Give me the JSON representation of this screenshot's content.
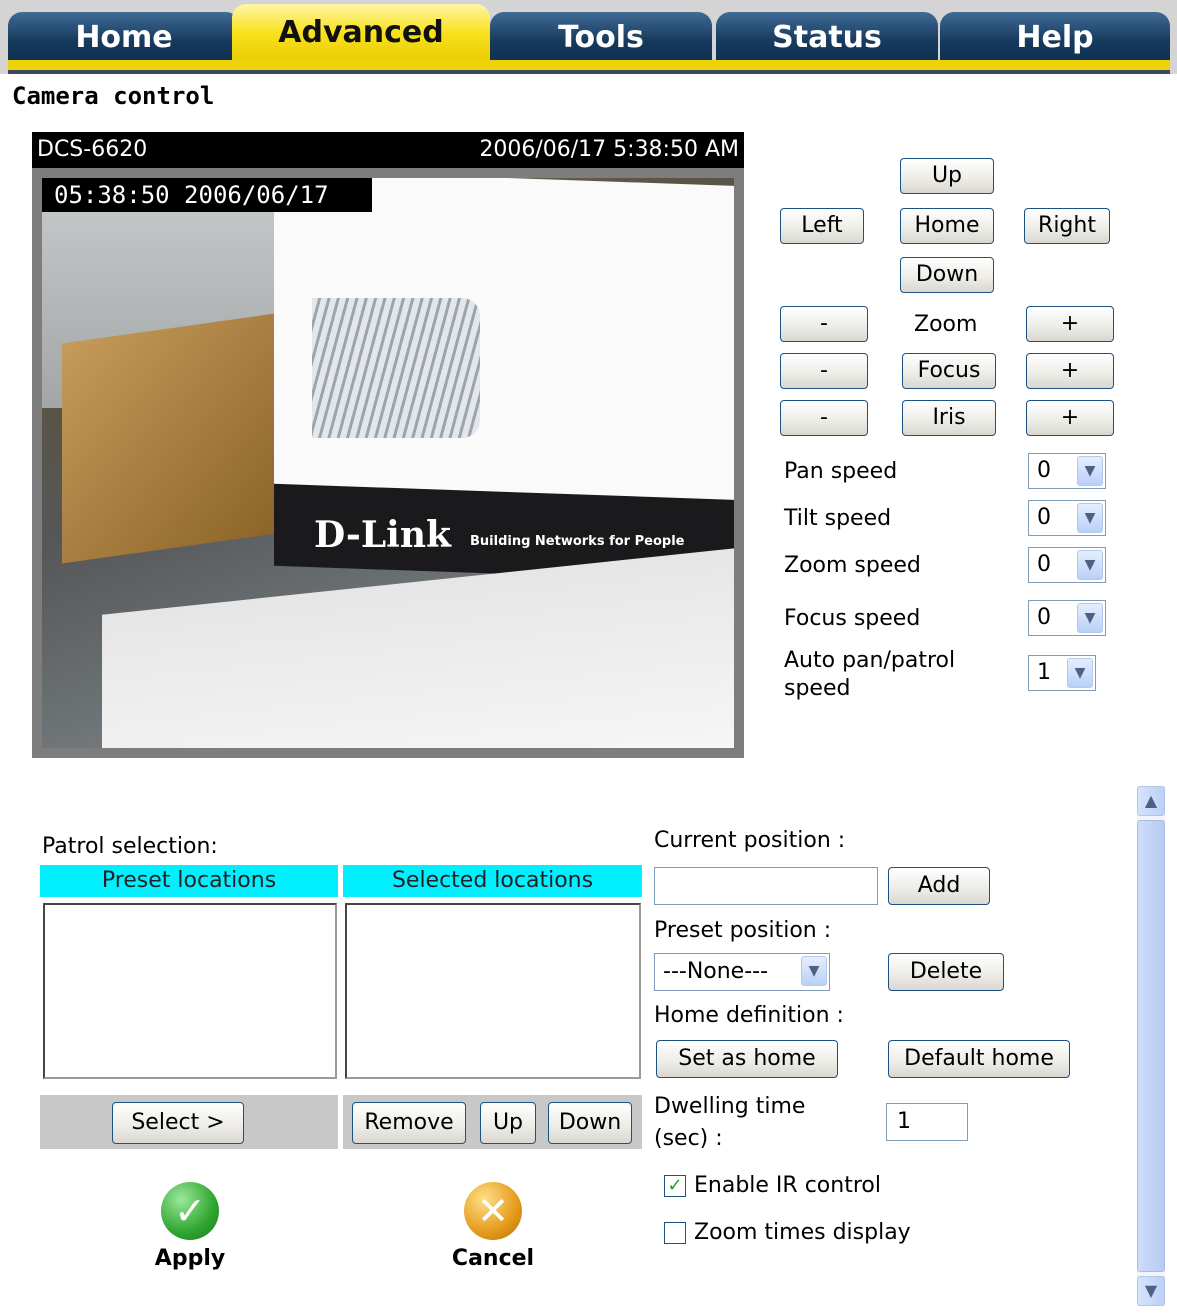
{
  "tabs": [
    {
      "label": "Home",
      "active": false
    },
    {
      "label": "Advanced",
      "active": true
    },
    {
      "label": "Tools",
      "active": false
    },
    {
      "label": "Status",
      "active": false
    },
    {
      "label": "Help",
      "active": false
    }
  ],
  "page_title": "Camera control",
  "camera": {
    "name": "DCS-6620",
    "timestamp": "2006/06/17 5:38:50 AM",
    "osd": "05:38:50  2006/06/17",
    "logo_text": "D-Link",
    "logo_tagline": "Building Networks for People"
  },
  "ptz": {
    "up": "Up",
    "left": "Left",
    "home": "Home",
    "right": "Right",
    "down": "Down",
    "minus": "-",
    "plus": "+",
    "zoom": "Zoom",
    "focus": "Focus",
    "iris": "Iris"
  },
  "speeds": {
    "pan_label": "Pan speed",
    "pan_value": "0",
    "tilt_label": "Tilt speed",
    "tilt_value": "0",
    "zoom_label": "Zoom speed",
    "zoom_value": "0",
    "focus_label": "Focus speed",
    "focus_value": "0",
    "auto_label_1": "Auto pan/patrol",
    "auto_label_2": "speed",
    "auto_value": "1"
  },
  "patrol": {
    "label": "Patrol selection:",
    "preset_header": "Preset locations",
    "selected_header": "Selected locations",
    "select_button": "Select >",
    "remove_button": "Remove",
    "up_button": "Up",
    "down_button": "Down"
  },
  "position": {
    "current_label": "Current position :",
    "current_value": "",
    "add_button": "Add",
    "preset_label": "Preset position :",
    "preset_value": "---None---",
    "delete_button": "Delete",
    "home_label": "Home definition :",
    "set_home_button": "Set as home",
    "default_home_button": "Default home",
    "dwell_label_1": "Dwelling time",
    "dwell_label_2": "(sec) :",
    "dwell_value": "1"
  },
  "options": {
    "ir_label": "Enable IR control",
    "ir_checked": true,
    "zoom_times_label": "Zoom times display",
    "zoom_times_checked": false
  },
  "actions": {
    "apply": "Apply",
    "cancel": "Cancel"
  },
  "icons": {
    "apply": "checkmark-icon",
    "cancel": "x-icon",
    "dropdown": "chevron-down-icon",
    "scroll_up": "chevron-up-icon",
    "scroll_down": "chevron-down-icon"
  },
  "colors": {
    "tab_active": "#f8e21f",
    "tab_inactive": "#16395c",
    "list_header": "#00f0ff",
    "apply_green": "#2fa52f",
    "cancel_orange": "#e49a1a"
  }
}
